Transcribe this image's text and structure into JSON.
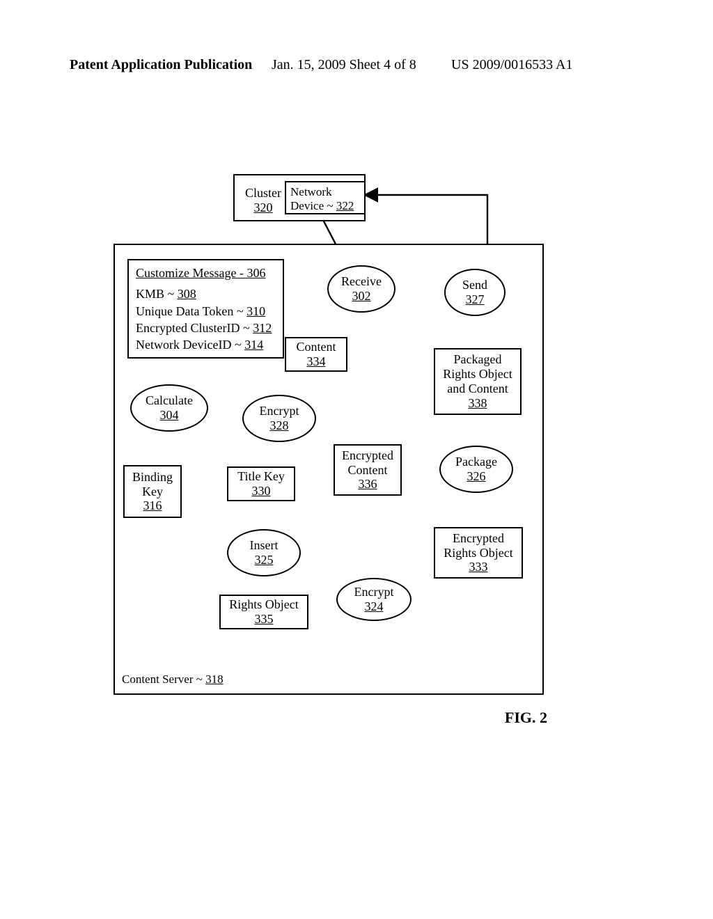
{
  "header": {
    "left": "Patent Application Publication",
    "center": "Jan. 15, 2009  Sheet 4 of 8",
    "right": "US 2009/0016533 A1"
  },
  "figure_caption": "FIG. 2",
  "cluster": {
    "label": "Cluster",
    "ref": "320"
  },
  "network_device": {
    "prefix": "Network Device ~ ",
    "ref": "322"
  },
  "customize": {
    "title_pre": "Customize Message - ",
    "title_ref": "306",
    "kmb_pre": "KMB ~ ",
    "kmb_ref": "308",
    "token_pre": "Unique Data Token ~ ",
    "token_ref": "310",
    "ecid_pre": "Encrypted ClusterID ~ ",
    "ecid_ref": "312",
    "ndid_pre": "Network DeviceID ~ ",
    "ndid_ref": "314"
  },
  "receive": {
    "label": "Receive",
    "ref": "302"
  },
  "send": {
    "label": "Send",
    "ref": "327"
  },
  "calculate": {
    "label": "Calculate",
    "ref": "304"
  },
  "encrypt_main": {
    "label": "Encrypt",
    "ref": "328"
  },
  "encrypt_ro": {
    "label": "Encrypt",
    "ref": "324"
  },
  "insert": {
    "label": "Insert",
    "ref": "325"
  },
  "package": {
    "label": "Package",
    "ref": "326"
  },
  "content": {
    "label": "Content",
    "ref": "334"
  },
  "enc_content": {
    "line1": "Encrypted",
    "line2": "Content",
    "ref": "336"
  },
  "title_key": {
    "label": "Title Key",
    "ref": "330"
  },
  "binding_key": {
    "line1": "Binding",
    "line2": "Key",
    "ref": "316"
  },
  "rights_object": {
    "label": "Rights Object",
    "ref": "335"
  },
  "enc_rights": {
    "line1": "Encrypted",
    "line2": "Rights Object",
    "ref": "333"
  },
  "packaged_out": {
    "l1": "Packaged",
    "l2": "Rights Object",
    "l3": "and Content",
    "ref": "338"
  },
  "server": {
    "prefix": "Content Server ~ ",
    "ref": "318"
  }
}
